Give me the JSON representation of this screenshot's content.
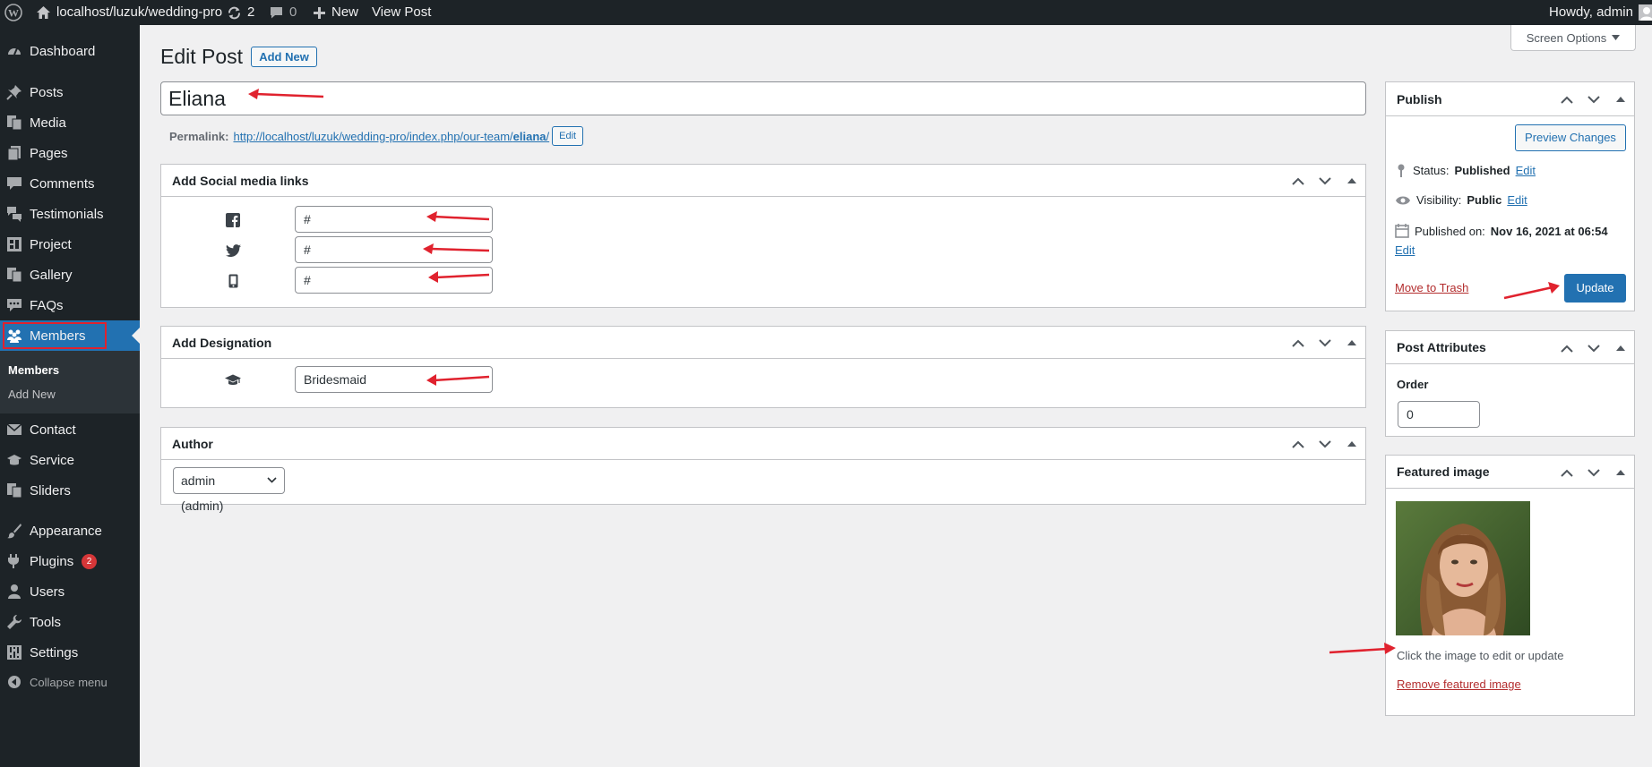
{
  "adminbar": {
    "site_name": "localhost/luzuk/wedding-pro",
    "updates_count": "2",
    "comments_count": "0",
    "new_label": "New",
    "view_post_label": "View Post",
    "howdy": "Howdy, admin"
  },
  "sidebar": {
    "items": [
      {
        "label": "Dashboard",
        "icon": "dashboard-icon"
      },
      {
        "label": "Posts",
        "icon": "pin-icon"
      },
      {
        "label": "Media",
        "icon": "media-icon"
      },
      {
        "label": "Pages",
        "icon": "pages-icon"
      },
      {
        "label": "Comments",
        "icon": "comments-icon"
      },
      {
        "label": "Testimonials",
        "icon": "testimonials-icon"
      },
      {
        "label": "Project",
        "icon": "project-icon"
      },
      {
        "label": "Gallery",
        "icon": "gallery-icon"
      },
      {
        "label": "FAQs",
        "icon": "faqs-icon"
      },
      {
        "label": "Members",
        "icon": "members-icon"
      },
      {
        "label": "Contact",
        "icon": "mail-icon"
      },
      {
        "label": "Service",
        "icon": "service-icon"
      },
      {
        "label": "Sliders",
        "icon": "sliders-icon"
      },
      {
        "label": "Appearance",
        "icon": "brush-icon"
      },
      {
        "label": "Plugins",
        "icon": "plugin-icon",
        "badge": "2"
      },
      {
        "label": "Users",
        "icon": "user-icon"
      },
      {
        "label": "Tools",
        "icon": "wrench-icon"
      },
      {
        "label": "Settings",
        "icon": "settings-icon"
      },
      {
        "label": "Collapse menu",
        "icon": "collapse-icon"
      }
    ],
    "submenu": [
      "Members",
      "Add New"
    ]
  },
  "page": {
    "title": "Edit Post",
    "add_new": "Add New",
    "screen_options": "Screen Options",
    "post_title": "Eliana",
    "permalink_label": "Permalink:",
    "permalink_base": "http://localhost/luzuk/wedding-pro/index.php/our-team/",
    "permalink_slug": "eliana",
    "permalink_trail": "/",
    "permalink_edit": "Edit"
  },
  "social_box": {
    "title": "Add Social media links",
    "rows": [
      {
        "icon": "facebook-icon",
        "value": "#"
      },
      {
        "icon": "twitter-icon",
        "value": "#"
      },
      {
        "icon": "phone-icon",
        "value": "#"
      }
    ]
  },
  "designation_box": {
    "title": "Add Designation",
    "icon": "graduation-cap-icon",
    "value": "Bridesmaid"
  },
  "author_box": {
    "title": "Author",
    "selected": "admin (admin)"
  },
  "publish_box": {
    "title": "Publish",
    "preview": "Preview Changes",
    "status_label": "Status:",
    "status_value": "Published",
    "visibility_label": "Visibility:",
    "visibility_value": "Public",
    "published_label": "Published on:",
    "published_value": "Nov 16, 2021 at 06:54",
    "edit": "Edit",
    "trash": "Move to Trash",
    "update": "Update"
  },
  "attributes_box": {
    "title": "Post Attributes",
    "order_label": "Order",
    "order_value": "0"
  },
  "featured_box": {
    "title": "Featured image",
    "hint": "Click the image to edit or update",
    "remove": "Remove featured image"
  },
  "colors": {
    "admin_dark": "#1d2327",
    "accent": "#2271b1",
    "annotation_red": "#e0222e"
  }
}
